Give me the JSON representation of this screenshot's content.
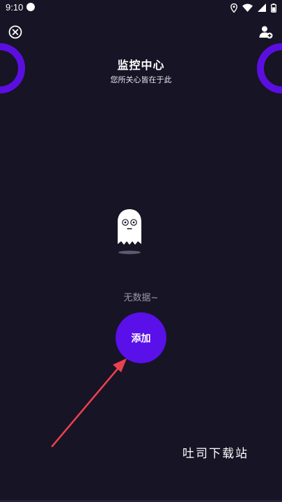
{
  "status_bar": {
    "time": "9:10"
  },
  "header": {
    "title": "监控中心",
    "subtitle": "您所关心皆在于此"
  },
  "icons": {
    "close": "close-circle-icon",
    "add_user": "person-add-icon",
    "location": "location-icon",
    "wifi": "wifi-icon",
    "signal": "signal-icon",
    "battery": "battery-icon"
  },
  "empty_state": {
    "message": "无数据~",
    "illustration": "ghost-icon"
  },
  "actions": {
    "add_label": "添加"
  },
  "watermark": "吐司下载站",
  "colors": {
    "background": "#171425",
    "accent": "#5a10e8",
    "ring": "#5a0fe0",
    "arrow": "#e8414f"
  }
}
